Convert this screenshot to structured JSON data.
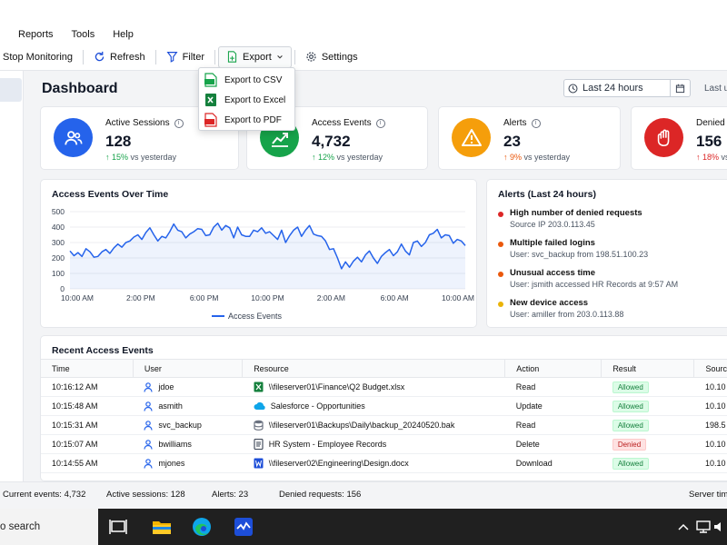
{
  "menu": [
    "Reports",
    "Tools",
    "Help"
  ],
  "toolbar": {
    "stop_monitoring": "Stop Monitoring",
    "refresh": "Refresh",
    "filter": "Filter",
    "export": "Export",
    "settings": "Settings"
  },
  "export_menu": [
    "Export to CSV",
    "Export to Excel",
    "Export to PDF"
  ],
  "dashboard": {
    "title": "Dashboard",
    "date_range": "Last 24 hours",
    "last_updated": "Last up"
  },
  "cards": [
    {
      "label": "Active Sessions",
      "value": "128",
      "change": "↑ 15%",
      "compare": "vs yesterday",
      "color": "#2563eb"
    },
    {
      "label": "Access Events",
      "value": "4,732",
      "change": "↑ 12%",
      "compare": "vs yesterday",
      "color": "#16a34a"
    },
    {
      "label": "Alerts",
      "value": "23",
      "change": "↑ 9%",
      "compare": "vs yesterday",
      "color": "#f59e0b"
    },
    {
      "label": "Denied R",
      "value": "156",
      "change": "↑ 18%",
      "compare": "vs",
      "color": "#dc2626"
    }
  ],
  "chart_data": {
    "type": "line",
    "title": "Access Events Over Time",
    "legend": "Access Events",
    "ylim": [
      0,
      500
    ],
    "yticks": [
      "0",
      "100",
      "200",
      "300",
      "400",
      "500"
    ],
    "xticks": [
      "10:00 AM",
      "2:00 PM",
      "6:00 PM",
      "10:00 PM",
      "2:00 AM",
      "6:00 AM",
      "10:00 AM"
    ],
    "color": "#2563eb",
    "series": [
      {
        "values": [
          245,
          215,
          235,
          210,
          260,
          240,
          205,
          210,
          240,
          255,
          230,
          265,
          290,
          270,
          300,
          310,
          335,
          350,
          320,
          365,
          395,
          350,
          310,
          340,
          330,
          370,
          420,
          380,
          370,
          330,
          355,
          370,
          390,
          385,
          345,
          350,
          400,
          425,
          380,
          410,
          395,
          330,
          400,
          350,
          340,
          340,
          380,
          370,
          395,
          360,
          370,
          345,
          320,
          380,
          300,
          345,
          380,
          400,
          340,
          380,
          410,
          355,
          345,
          340,
          310,
          255,
          260,
          200,
          130,
          175,
          140,
          180,
          205,
          175,
          220,
          245,
          200,
          165,
          210,
          235,
          255,
          215,
          240,
          290,
          245,
          220,
          300,
          310,
          275,
          300,
          350,
          360,
          385,
          330,
          350,
          345,
          295,
          320,
          310,
          280
        ]
      }
    ]
  },
  "alerts_panel": {
    "title": "Alerts (Last 24 hours)",
    "items": [
      {
        "title": "High number of denied requests",
        "detail": "Source IP 203.0.113.45",
        "color": "#dc2626"
      },
      {
        "title": "Multiple failed logins",
        "detail": "User: svc_backup from 198.51.100.23",
        "color": "#ea580c"
      },
      {
        "title": "Unusual access time",
        "detail": "User: jsmith accessed HR Records at 9:57 AM",
        "color": "#ea580c"
      },
      {
        "title": "New device access",
        "detail": "User: amiller from 203.0.113.88",
        "color": "#eab308"
      }
    ]
  },
  "events": {
    "title": "Recent Access Events",
    "columns": [
      "Time",
      "User",
      "Resource",
      "Action",
      "Result",
      "Sourc"
    ],
    "rows": [
      {
        "time": "10:16:12 AM",
        "user": "jdoe",
        "resource": "\\\\fileserver01\\Finance\\Q2 Budget.xlsx",
        "icon": "excel-icon",
        "action": "Read",
        "result": "Allowed",
        "source": "10.10"
      },
      {
        "time": "10:15:48 AM",
        "user": "asmith",
        "resource": "Salesforce - Opportunities",
        "icon": "cloud-icon",
        "action": "Update",
        "result": "Allowed",
        "source": "10.10"
      },
      {
        "time": "10:15:31 AM",
        "user": "svc_backup",
        "resource": "\\\\fileserver01\\Backups\\Daily\\backup_20240520.bak",
        "icon": "database-icon",
        "action": "Read",
        "result": "Allowed",
        "source": "198.5"
      },
      {
        "time": "10:15:07 AM",
        "user": "bwilliams",
        "resource": "HR System - Employee Records",
        "icon": "document-icon",
        "action": "Delete",
        "result": "Denied",
        "source": "10.10"
      },
      {
        "time": "10:14:55 AM",
        "user": "mjones",
        "resource": "\\\\fileserver02\\Engineering\\Design.docx",
        "icon": "word-icon",
        "action": "Download",
        "result": "Allowed",
        "source": "10.10"
      }
    ]
  },
  "statusbar": {
    "current": "Current events: 4,732",
    "sessions": "Active sessions: 128",
    "alerts": "Alerts: 23",
    "denied": "Denied requests: 156",
    "server": "Server tim"
  },
  "taskbar": {
    "search": "o search"
  }
}
